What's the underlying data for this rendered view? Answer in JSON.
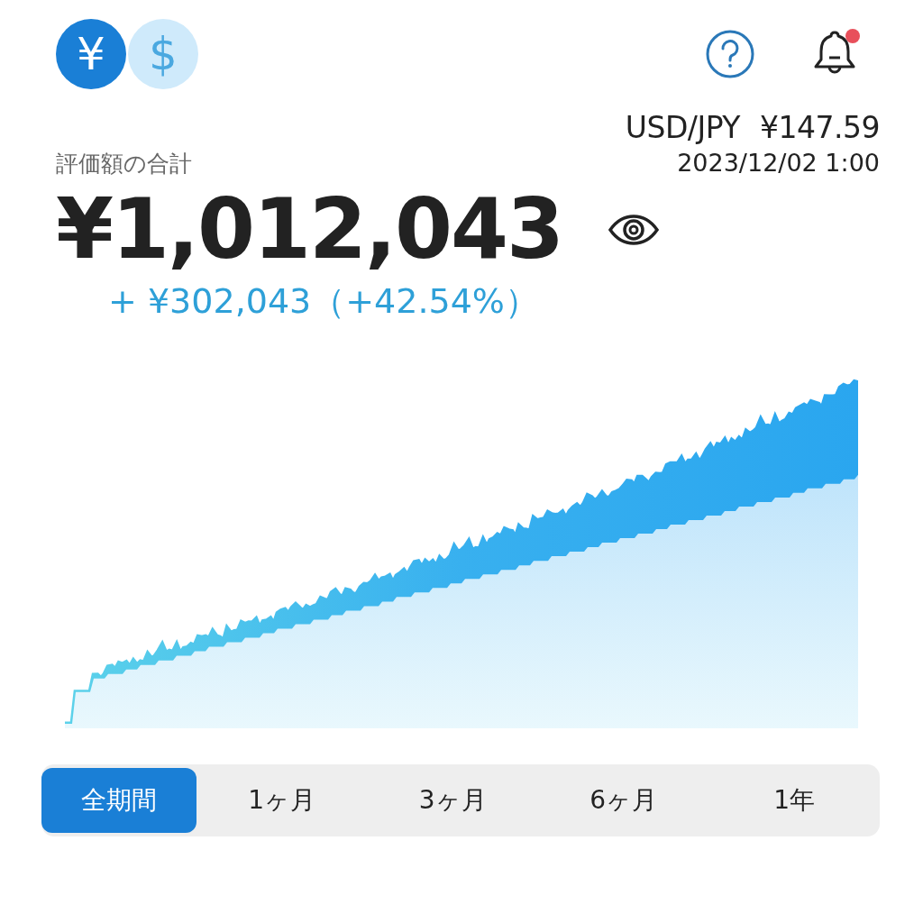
{
  "currencies": [
    {
      "symbol": "¥",
      "selected": true
    },
    {
      "symbol": "$",
      "selected": false
    }
  ],
  "notifications": {
    "unread": true
  },
  "rate": {
    "pair": "USD/JPY",
    "value": "¥147.59",
    "time": "2023/12/02 1:00"
  },
  "total": {
    "label": "評価額の合計",
    "amount": "¥1,012,043",
    "change": "+ ¥302,043（+42.54%）"
  },
  "periods": [
    {
      "label": "全期間",
      "selected": true
    },
    {
      "label": "1ヶ月",
      "selected": false
    },
    {
      "label": "3ヶ月",
      "selected": false
    },
    {
      "label": "6ヶ月",
      "selected": false
    },
    {
      "label": "1年",
      "selected": false
    }
  ]
}
